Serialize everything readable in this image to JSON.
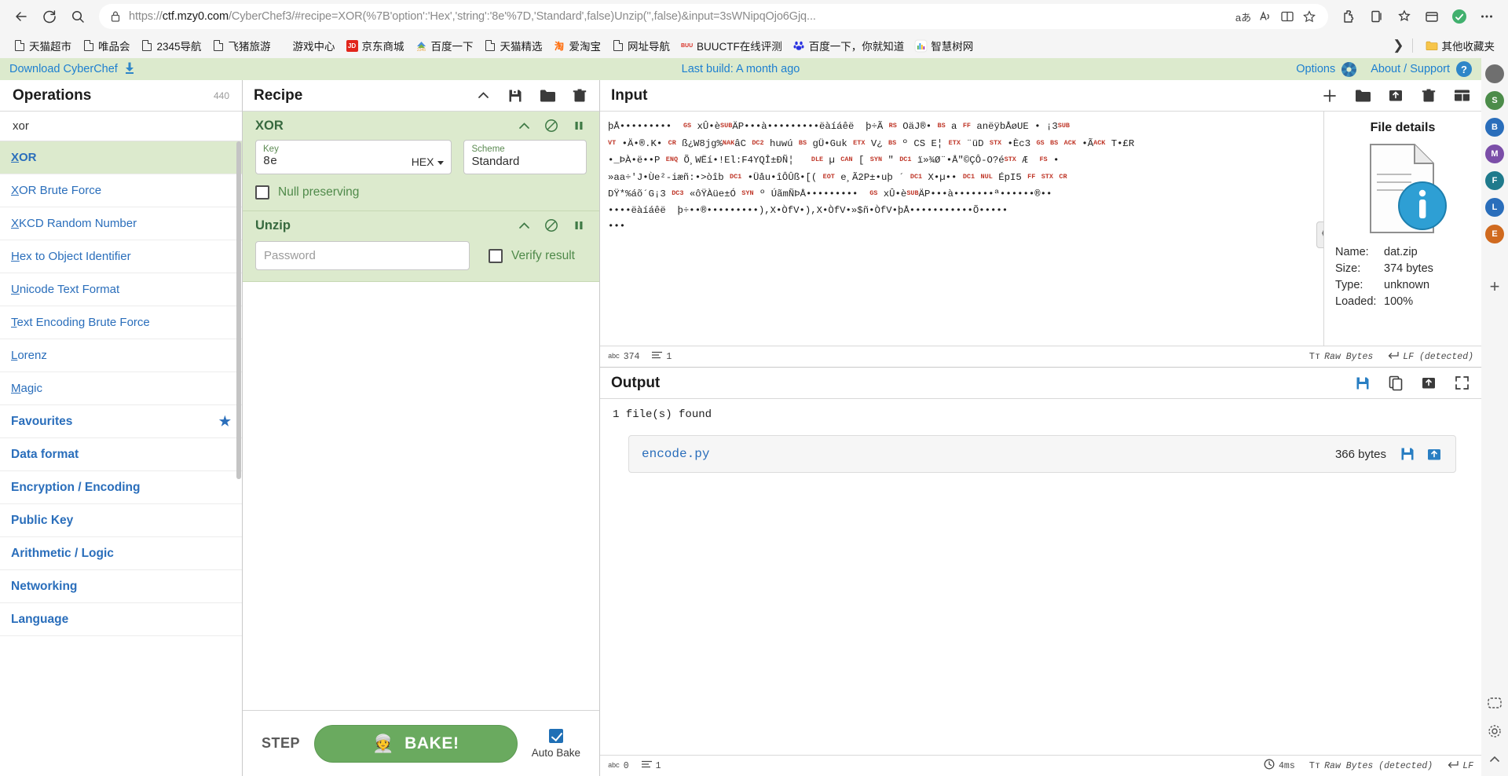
{
  "browser": {
    "url_prefix": "https://",
    "url_host": "ctf.mzy0.com",
    "url_path": "/CyberChef3/#recipe=XOR(%7B'option':'Hex','string':'8e'%7D,'Standard',false)Unzip('',false)&input=3sWNipqOjo6Gjq...",
    "back_icon": "back-arrow-icon",
    "reload_icon": "reload-icon",
    "search_icon": "search-icon",
    "lock_icon": "lock-icon",
    "translate_icon": "translate-icon",
    "read_aloud_icon": "read-aloud-icon",
    "split_screen_icon": "split-screen-icon",
    "favorite_icon": "star-icon",
    "extensions_icon": "extensions-icon",
    "browser_essentials_icon": "browser-essentials-icon",
    "collections_icon": "collections-icon",
    "profile_icon": "profile-icon",
    "settings_icon": "more-settings-icon",
    "bookmarks": [
      {
        "label": "天猫超市",
        "icon": "page-icon"
      },
      {
        "label": "唯品会",
        "icon": "page-icon"
      },
      {
        "label": "2345导航",
        "icon": "page-icon"
      },
      {
        "label": "飞猪旅游",
        "icon": "page-icon"
      },
      {
        "label": "游戏中心",
        "icon": "none"
      },
      {
        "label": "京东商城",
        "icon": "jd-icon"
      },
      {
        "label": "百度一下",
        "icon": "2345-icon"
      },
      {
        "label": "天猫精选",
        "icon": "page-icon"
      },
      {
        "label": "爱淘宝",
        "icon": "taobao-icon"
      },
      {
        "label": "网址导航",
        "icon": "page-icon"
      },
      {
        "label": "BUUCTF在线评测",
        "icon": "buuctf-icon"
      },
      {
        "label": "百度一下，你就知道",
        "icon": "baidu-icon"
      },
      {
        "label": "智慧树网",
        "icon": "zhihuishu-icon"
      }
    ],
    "bookmark_overflow_icon": "chevron-right-icon",
    "other_favorites": {
      "label": "其他收藏夹",
      "icon": "folder-icon"
    }
  },
  "rail": {
    "avatars": [
      {
        "letter": "",
        "color": "#6f6f6f"
      },
      {
        "letter": "S",
        "color": "#4c8c4a"
      },
      {
        "letter": "B",
        "color": "#2a6ebb"
      },
      {
        "letter": "M",
        "color": "#7b4ea8"
      },
      {
        "letter": "F",
        "color": "#1f7a8c"
      },
      {
        "letter": "L",
        "color": "#2a6ebb"
      },
      {
        "letter": "E",
        "color": "#d06a1f"
      }
    ],
    "add_icon": "plus-icon",
    "tool1_icon": "copilot-icon",
    "tool2_icon": "gear-icon",
    "tool3_icon": "chevron-up-icon"
  },
  "banner": {
    "download_label": "Download CyberChef",
    "download_icon": "download-icon",
    "last_build": "Last build: A month ago",
    "options_label": "Options",
    "options_icon": "gear-icon",
    "about_label": "About / Support",
    "about_icon": "question-circle-icon"
  },
  "operations": {
    "title": "Operations",
    "count": "440",
    "search_value": "xor",
    "search_placeholder": "Search...",
    "results": [
      {
        "label": "XOR",
        "highlight": true
      },
      {
        "label": "XOR Brute Force",
        "highlight": false
      },
      {
        "label": "XKCD Random Number",
        "highlight": false
      },
      {
        "label": "Hex to Object Identifier",
        "highlight": false
      },
      {
        "label": "Unicode Text Format",
        "highlight": false
      },
      {
        "label": "Text Encoding Brute Force",
        "highlight": false
      },
      {
        "label": "Lorenz",
        "highlight": false
      },
      {
        "label": "Magic",
        "highlight": false
      }
    ],
    "categories": [
      {
        "label": "Favourites",
        "star": true
      },
      {
        "label": "Data format",
        "star": false
      },
      {
        "label": "Encryption / Encoding",
        "star": false
      },
      {
        "label": "Public Key",
        "star": false
      },
      {
        "label": "Arithmetic / Logic",
        "star": false
      },
      {
        "label": "Networking",
        "star": false
      },
      {
        "label": "Language",
        "star": false
      }
    ]
  },
  "recipe": {
    "title": "Recipe",
    "tools": [
      {
        "name": "collapse-icon",
        "glyph": "chevron-up-icon"
      },
      {
        "name": "save-recipe-icon",
        "glyph": "save-icon"
      },
      {
        "name": "load-recipe-icon",
        "glyph": "folder-icon"
      },
      {
        "name": "clear-recipe-icon",
        "glyph": "trash-icon"
      }
    ],
    "operations": [
      {
        "name": "XOR",
        "controls": [
          "chevron-up-icon",
          "disable-icon",
          "pause-icon"
        ],
        "args": [
          {
            "label": "Key",
            "value": "8e",
            "suffix": "HEX",
            "has_dropdown": true
          },
          {
            "label": "Scheme",
            "value": "Standard",
            "suffix": "",
            "has_dropdown": false
          }
        ],
        "checkbox": {
          "label": "Null preserving",
          "checked": false
        }
      },
      {
        "name": "Unzip",
        "controls": [
          "chevron-up-icon",
          "disable-icon",
          "pause-icon"
        ],
        "password_placeholder": "Password",
        "password_value": "",
        "checkbox": {
          "label": "Verify result",
          "checked": false
        }
      }
    ],
    "step_label": "STEP",
    "bake_label": "BAKE!",
    "bake_icon": "chef-icon",
    "autobake_label": "Auto Bake",
    "autobake_checked": true,
    "bake_color": "#6aaa5f"
  },
  "input": {
    "title": "Input",
    "tools": [
      {
        "name": "add-tab-icon"
      },
      {
        "name": "open-folder-icon"
      },
      {
        "name": "open-file-icon"
      },
      {
        "name": "clear-io-icon"
      },
      {
        "name": "reset-layout-icon"
      }
    ],
    "lines": [
      "þÅ•••••••••  GS xÛ•èSUBÄP•••à•••••••••ëàíáêë  þ÷Ã RS OäJ®• BS a FF anëÿbÅøUE • ¡3SUB",
      "VT •Ä•®.K• CR ß¿W8jg%NAKâC DC2 huwú BS gÜ•Guk ETX V¿ BS º CS E¦ ETX ¨üD STX •Èc3 GS BS ACK •ÃACK T•£R",
      "•_ÞÀ•ë••P ENQ Õ¸WËí•!El:F4YQÎ±ÐÑ¦   DLE µ CAN [ SYN \" DC1 ï»¾Ø¨•Å\"©ÇÔ-O?éSTX Æ  FS •",
      "»aa÷'J•Ùe²-iæñ:•>òîb DC1 •Üåu•îÔÛß•[( EOT e¸Ã2P±•uþ ´ DC1 X•µ•• DC1 NUL ÉpI5 FF STX CR",
      "DŸ*%áõ´G¡3 DC3 «ôŸÀüe±Ó SYN º ÚãmÑÞÅ•••••••••  GS xÛ•èSUBÄP•••à•••••••ª••••••®••",
      "••••ëàíáêë  þ÷••®•••••••••),X•ÒfV•),X•ÒfV•»$ñ•ÒfV•þÅ•••••••••••Õ•••••",
      "•••"
    ],
    "status": {
      "length_icon": "abc-icon",
      "length": "374",
      "lines_icon": "lines-icon",
      "lines": "1",
      "encoding_icon": "font-icon",
      "encoding": "Raw Bytes",
      "linebreak_icon": "enter-icon",
      "linebreak": "LF (detected)"
    }
  },
  "file_details": {
    "title": "File details",
    "thumb_icon": "file-info-icon",
    "rows": [
      {
        "key": "Name:",
        "value": "dat.zip"
      },
      {
        "key": "Size:",
        "value": "374 bytes"
      },
      {
        "key": "Type:",
        "value": "unknown"
      },
      {
        "key": "Loaded:",
        "value": "100%"
      }
    ]
  },
  "output": {
    "title": "Output",
    "tools": [
      {
        "name": "save-output-icon"
      },
      {
        "name": "copy-output-icon"
      },
      {
        "name": "replace-input-icon"
      },
      {
        "name": "maximise-output-icon"
      }
    ],
    "found_text": "1 file(s) found",
    "files": [
      {
        "name": "encode.py",
        "size": "366 bytes",
        "save_icon": "save-icon",
        "open-icon": "open-in-tab-icon"
      }
    ],
    "status": {
      "length_icon": "abc-icon",
      "length": "0",
      "lines_icon": "lines-icon",
      "lines": "1",
      "time_icon": "clock-icon",
      "time": "4ms",
      "encoding_icon": "font-icon",
      "encoding": "Raw Bytes (detected)",
      "linebreak_icon": "enter-icon",
      "linebreak": "LF"
    }
  }
}
